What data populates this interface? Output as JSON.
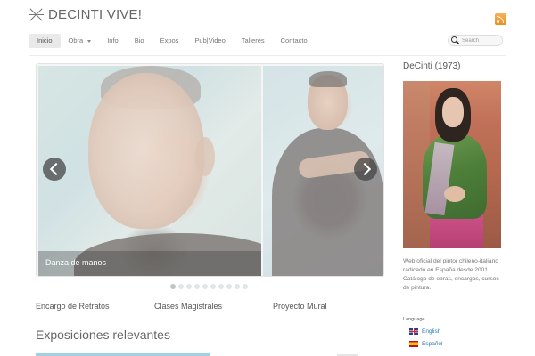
{
  "header": {
    "site_title": "DECINTI VIVE!"
  },
  "nav": {
    "items": [
      {
        "label": "Inicio",
        "active": true
      },
      {
        "label": "Obra",
        "has_dropdown": true
      },
      {
        "label": "Info"
      },
      {
        "label": "Bio"
      },
      {
        "label": "Expos"
      },
      {
        "label": "Pub|Video"
      },
      {
        "label": "Talleres"
      },
      {
        "label": "Contacto"
      }
    ],
    "search_placeholder": "Search"
  },
  "slider": {
    "caption": "Danza de manos",
    "slide_count": 10,
    "active_slide": 1
  },
  "features": [
    {
      "label": "Encargo de Retratos"
    },
    {
      "label": "Clases Magistrales"
    },
    {
      "label": "Proyecto Mural"
    }
  ],
  "exhibitions": {
    "heading": "Exposiciones relevantes"
  },
  "sidebar": {
    "title": "DeCinti (1973)",
    "description": "Web oficial del pintor chileno-italiano radicado en España desde 2001. Catálogo de obras, encargos, cursos de pintura.",
    "language_title": "Language",
    "languages": [
      {
        "label": "English",
        "flag": "uk-flag-icon"
      },
      {
        "label": "Español",
        "flag": "spain-flag-icon"
      }
    ]
  },
  "colors": {
    "link": "#2a7ab8",
    "rss": "#ec8f1e",
    "accent_bar": "#9fd0e4"
  }
}
